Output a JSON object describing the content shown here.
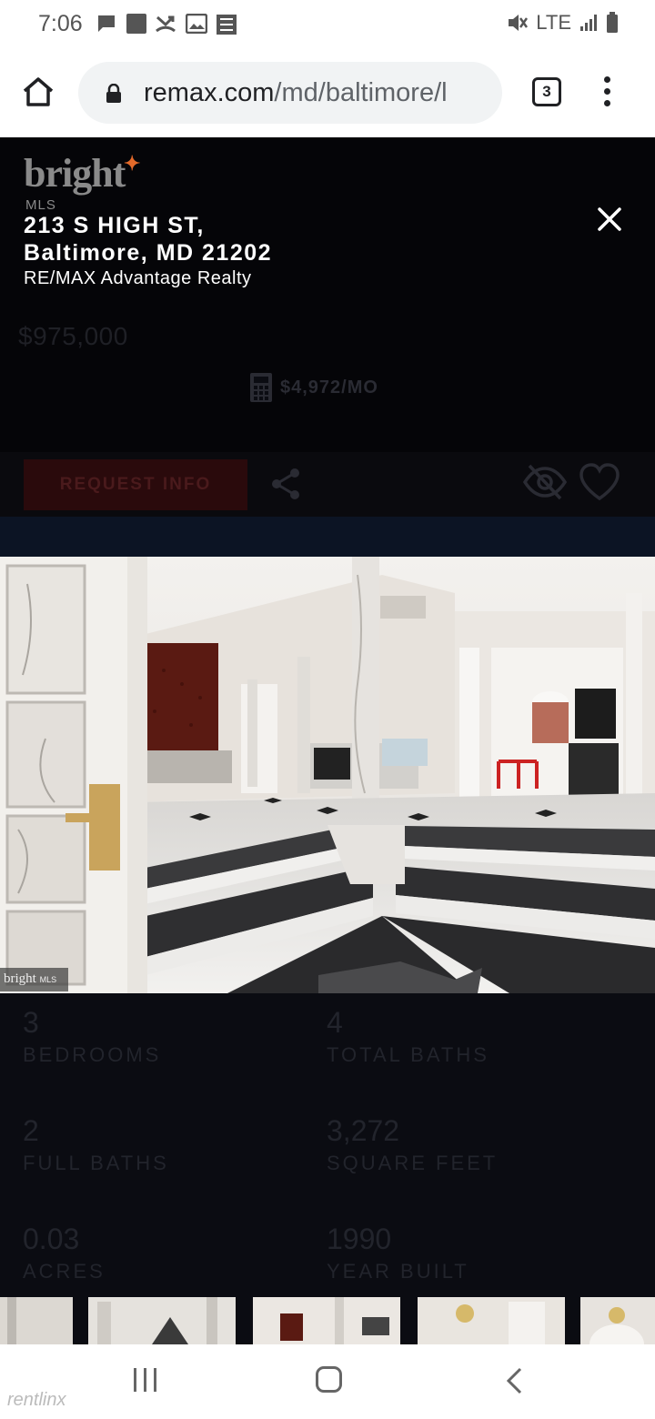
{
  "status_bar": {
    "time": "7:06",
    "network": "LTE",
    "icons": [
      "message-icon",
      "square-icon",
      "missed-call-icon",
      "image-icon",
      "app-icon",
      "mute-icon",
      "signal-icon",
      "battery-icon"
    ]
  },
  "browser": {
    "url_host": "remax.com",
    "url_path": "/md/baltimore/l",
    "tab_count": "3"
  },
  "listing": {
    "brand_logo": "bright",
    "brand_sub": "MLS",
    "address_line1": "213 S HIGH ST,",
    "address_line2": "Baltimore, MD 21202",
    "agency": "RE/MAX Advantage Realty",
    "price": "$975,000",
    "monthly": "$4,972/MO",
    "request_button": "REQUEST INFO",
    "watermark": "bright",
    "watermark_sub": "MLS"
  },
  "stats": [
    {
      "value": "3",
      "label": "BEDROOMS"
    },
    {
      "value": "4",
      "label": "TOTAL BATHS"
    },
    {
      "value": "2",
      "label": "FULL BATHS"
    },
    {
      "value": "3,272",
      "label": "SQUARE FEET"
    },
    {
      "value": "0.03",
      "label": "ACRES"
    },
    {
      "value": "1990",
      "label": "YEAR BUILT"
    }
  ],
  "footer": {
    "watermark": "rentlinx"
  },
  "colors": {
    "accent_red": "#2a0a0c",
    "background": "#0b0c12",
    "logo_star": "#e46a2a"
  }
}
